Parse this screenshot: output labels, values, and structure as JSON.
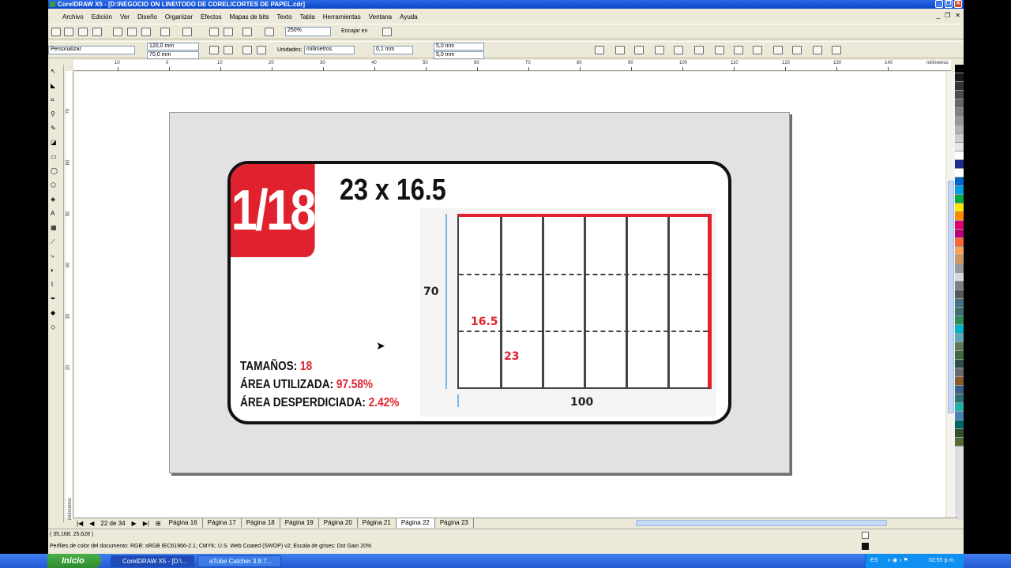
{
  "window": {
    "title": "CorelDRAW X5 - [D:\\NEGOCIO ON LINE\\TODO DE COREL\\CORTES DE PAPEL.cdr]"
  },
  "menu": [
    "Archivo",
    "Edición",
    "Ver",
    "Diseño",
    "Organizar",
    "Efectos",
    "Mapas de bits",
    "Texto",
    "Tabla",
    "Herramientas",
    "Ventana",
    "Ayuda"
  ],
  "toolbar1": {
    "zoom": "250%",
    "snap_label": "Encajar en"
  },
  "toolbar2": {
    "page_preset": "Personalizar",
    "width": "120,0 mm",
    "height": "70,0 mm",
    "units_label": "Unidades:",
    "units_value": "milímetros",
    "nudge": "0,1 mm",
    "dup_x": "5,0 mm",
    "dup_y": "5,0 mm"
  },
  "ruler": {
    "h_labels": [
      "10",
      "0",
      "10",
      "20",
      "30",
      "40",
      "50",
      "60",
      "70",
      "80",
      "90",
      "100",
      "110",
      "120",
      "130",
      "140"
    ],
    "h_unit": "milímetros",
    "v_labels": [
      "70",
      "60",
      "50",
      "40",
      "30",
      "20"
    ],
    "v_unit": "milímetros"
  },
  "artwork": {
    "fraction": "1/18",
    "size": "23 x 16.5",
    "stats": [
      {
        "label": "TAMAÑOS:",
        "value": "18"
      },
      {
        "label": "ÁREA UTILIZADA:",
        "value": "97.58%"
      },
      {
        "label": "ÁREA DESPERDICIADA:",
        "value": "2.42%"
      }
    ],
    "dim_height": "70",
    "dim_width": "100",
    "cell_h": "16.5",
    "cell_w": "23"
  },
  "pages": {
    "counter": "22 de 34",
    "tabs": [
      "Página 16",
      "Página 17",
      "Página 18",
      "Página 19",
      "Página 20",
      "Página 21",
      "Página 22",
      "Página 23"
    ],
    "active": "Página 22"
  },
  "status": {
    "coords": "( 35,168; 25,628 )",
    "color_profiles": "Perfiles de color del documento: RGB: sRGB IEC61966-2.1; CMYK: U.S. Web Coated (SWOP) v2; Escala de grises: Dot Gain 20%"
  },
  "taskbar": {
    "start": "Inicio",
    "items": [
      "CorelDRAW X5 - [D:\\...",
      "aTube Catcher 3.8.7..."
    ],
    "lang": "ES",
    "clock": "02:55 p.m."
  },
  "palette_colors": [
    "#000000",
    "#1a1a1a",
    "#333333",
    "#4d4d4d",
    "#666666",
    "#808080",
    "#999999",
    "#b3b3b3",
    "#cccccc",
    "#e6e6e6",
    "#ffffff",
    "#1e2b8f",
    "#ffffff",
    "#0066cc",
    "#00a0e0",
    "#00aa44",
    "#ffe600",
    "#ff8800",
    "#e0006c",
    "#c0007a",
    "#ff6633",
    "#f4a460",
    "#cc9966",
    "#999999",
    "#d9d9d9",
    "#7f7f7f",
    "#595959",
    "#4a6f8a",
    "#3b6f6f",
    "#2e8b57",
    "#00b4c8",
    "#5fa6b8",
    "#5a7a5a",
    "#3d6b3d",
    "#2f4f4f",
    "#6b6b6b",
    "#8b5a2b",
    "#3a5f8a",
    "#2e6f6f",
    "#20b2aa",
    "#4682b4",
    "#006666",
    "#2f4f2f",
    "#556b2f"
  ]
}
